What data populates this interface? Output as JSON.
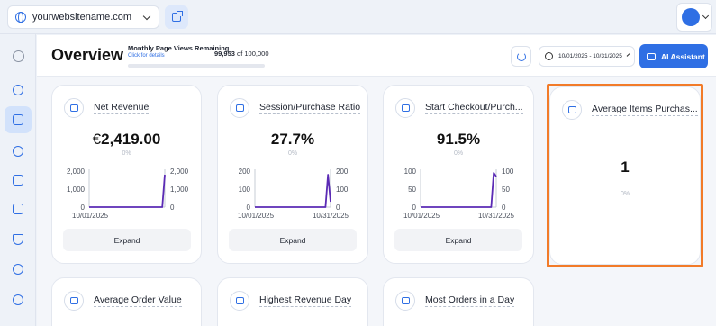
{
  "topbar": {
    "site_name": "yourwebsitename.com",
    "icons": {
      "site": "globe-icon",
      "external": "external-link-icon",
      "user": "user-avatar",
      "dropdown": "chevron-down-icon"
    }
  },
  "sidebar": {
    "items": [
      {
        "name": "home-icon"
      },
      {
        "name": "analytics-icon"
      },
      {
        "name": "ecommerce-icon",
        "active": true
      },
      {
        "name": "funnel-icon"
      },
      {
        "name": "target-icon"
      },
      {
        "name": "chat-icon"
      },
      {
        "name": "shield-icon"
      },
      {
        "name": "settings-icon"
      },
      {
        "name": "location-icon"
      }
    ]
  },
  "header": {
    "title": "Overview",
    "page_views": {
      "label": "Monthly Page Views Remaining",
      "link": "Click for details",
      "used": "99,953",
      "of_label": "of 100,000",
      "fraction": 0.0005
    },
    "date_range": "10/01/2025 - 10/31/2025",
    "ai_button": "AI Assistant"
  },
  "cards": [
    {
      "title": "Net Revenue",
      "currency": "€",
      "value": "2,419.00",
      "change": "0%",
      "expand": "Expand",
      "chart_data": {
        "type": "line",
        "x_labels": [
          "10/01/2025"
        ],
        "y_left_ticks": [
          "2,000",
          "1,000",
          "0"
        ],
        "y_right_ticks": [
          "2,000",
          "1,000",
          "0"
        ],
        "ylim": [
          0,
          2000
        ],
        "series": [
          {
            "values": [
              0,
              0,
              0,
              0,
              0,
              0,
              0,
              0,
              0,
              0,
              0,
              0,
              0,
              0,
              0,
              0,
              0,
              0,
              0,
              0,
              0,
              0,
              0,
              0,
              0,
              0,
              0,
              0,
              0,
              0,
              1800
            ]
          }
        ],
        "color": "#5b2bb5"
      }
    },
    {
      "title": "Session/Purchase Ratio",
      "value": "27.7%",
      "change": "0%",
      "expand": "Expand",
      "chart_data": {
        "type": "line",
        "x_labels": [
          "10/01/2025",
          "10/31/2025"
        ],
        "y_left_ticks": [
          "200",
          "100",
          "0"
        ],
        "y_right_ticks": [
          "200",
          "100",
          "0"
        ],
        "ylim": [
          0,
          200
        ],
        "series": [
          {
            "values": [
              0,
              0,
              0,
              0,
              0,
              0,
              0,
              0,
              0,
              0,
              0,
              0,
              0,
              0,
              0,
              0,
              0,
              0,
              0,
              0,
              0,
              0,
              0,
              0,
              0,
              0,
              0,
              0,
              0,
              180,
              30
            ]
          }
        ],
        "color": "#5b2bb5"
      }
    },
    {
      "title": "Start Checkout/Purch...",
      "value": "91.5%",
      "change": "0%",
      "expand": "Expand",
      "chart_data": {
        "type": "line",
        "x_labels": [
          "10/01/2025",
          "10/31/2025"
        ],
        "y_left_ticks": [
          "100",
          "50",
          "0"
        ],
        "y_right_ticks": [
          "100",
          "50",
          "0"
        ],
        "ylim": [
          0,
          100
        ],
        "series": [
          {
            "values": [
              0,
              0,
              0,
              0,
              0,
              0,
              0,
              0,
              0,
              0,
              0,
              0,
              0,
              0,
              0,
              0,
              0,
              0,
              0,
              0,
              0,
              0,
              0,
              0,
              0,
              0,
              0,
              0,
              0,
              95,
              85
            ]
          }
        ],
        "color": "#5b2bb5"
      }
    },
    {
      "title": "Average Items Purchas...",
      "value": "1",
      "change": "0%"
    },
    {
      "title": "Average Order Value"
    },
    {
      "title": "Highest Revenue Day"
    },
    {
      "title": "Most Orders in a Day"
    }
  ],
  "colors": {
    "accent": "#2f6fe4",
    "line": "#5b2bb5",
    "highlight": "#f27b29"
  }
}
